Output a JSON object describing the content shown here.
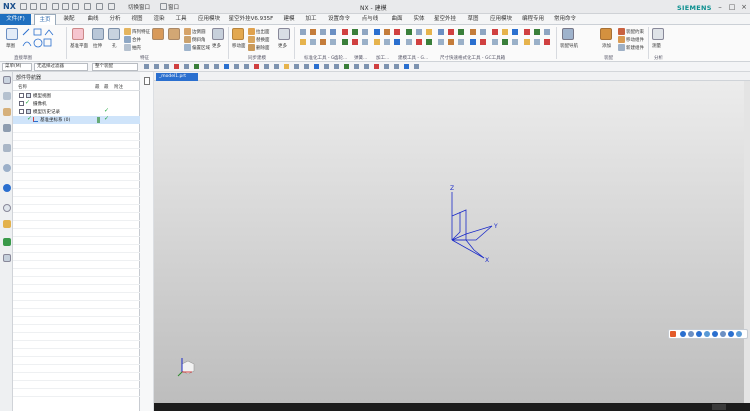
{
  "titlebar": {
    "logo": "NX",
    "switch_window": "切换窗口",
    "window_menu": "窗口",
    "title": "NX - 建模",
    "brand": "SIEMENS"
  },
  "menu": {
    "file": "文件(F)",
    "tabs": [
      "主页",
      "装配",
      "曲线",
      "分析",
      "视图",
      "渲染",
      "工具",
      "应用模块",
      "星空外挂V6.935F",
      "建模",
      "加工",
      "设置命令",
      "点与线",
      "曲面",
      "实体",
      "星空外挂",
      "草图",
      "应用模块",
      "编程专用",
      "常用命令"
    ],
    "active_index": 0
  },
  "ribbon": {
    "groups": [
      "直接草图",
      "特征",
      "同步建模",
      "标准化工具 - G...",
      "齿轮...",
      "弹簧...",
      "加工...",
      "建模工具 - G...",
      "尺寸快速格式化工具 - GC工具箱",
      "装配",
      "分析"
    ],
    "labels": {
      "sketch": "草图",
      "datum": "基准平面",
      "extrude": "拉伸",
      "hole": "孔",
      "pattern": "阵列特征",
      "unite": "合并",
      "shell": "抽壳",
      "edge_blend": "边倒圆",
      "chamfer": "倒斜角",
      "more": "更多",
      "move_face": "移动面",
      "pull_face": "拉出面",
      "replace_face": "替换面",
      "delete_face": "删除面",
      "offset": "偏置区域",
      "assembly_nav": "装配导航",
      "add": "添加",
      "constraints": "装配约束",
      "move_comp": "移动组件",
      "new_comp": "新建组件",
      "measure": "测量"
    }
  },
  "selection": {
    "menu": "菜单(M)",
    "filter": "无选择过滤器",
    "scope": "整个装配"
  },
  "navigator": {
    "title": "部件导航器",
    "columns": [
      "名称",
      "最",
      "最",
      "附注"
    ],
    "rows": [
      {
        "label": "模型视图",
        "check": ""
      },
      {
        "label": "摄像机",
        "check": ""
      },
      {
        "label": "模型历史记录",
        "check": "✓"
      },
      {
        "label": "基准坐标系 (0)",
        "check": "✓"
      }
    ]
  },
  "document": {
    "tab": "_model1.prt"
  },
  "axes": [
    "Z",
    "Y",
    "X"
  ],
  "colors": {
    "accent": "#1f6fbf",
    "tab_active": "#2a6fcf",
    "check": "#1aa337",
    "axis": "#1a2ac8"
  }
}
